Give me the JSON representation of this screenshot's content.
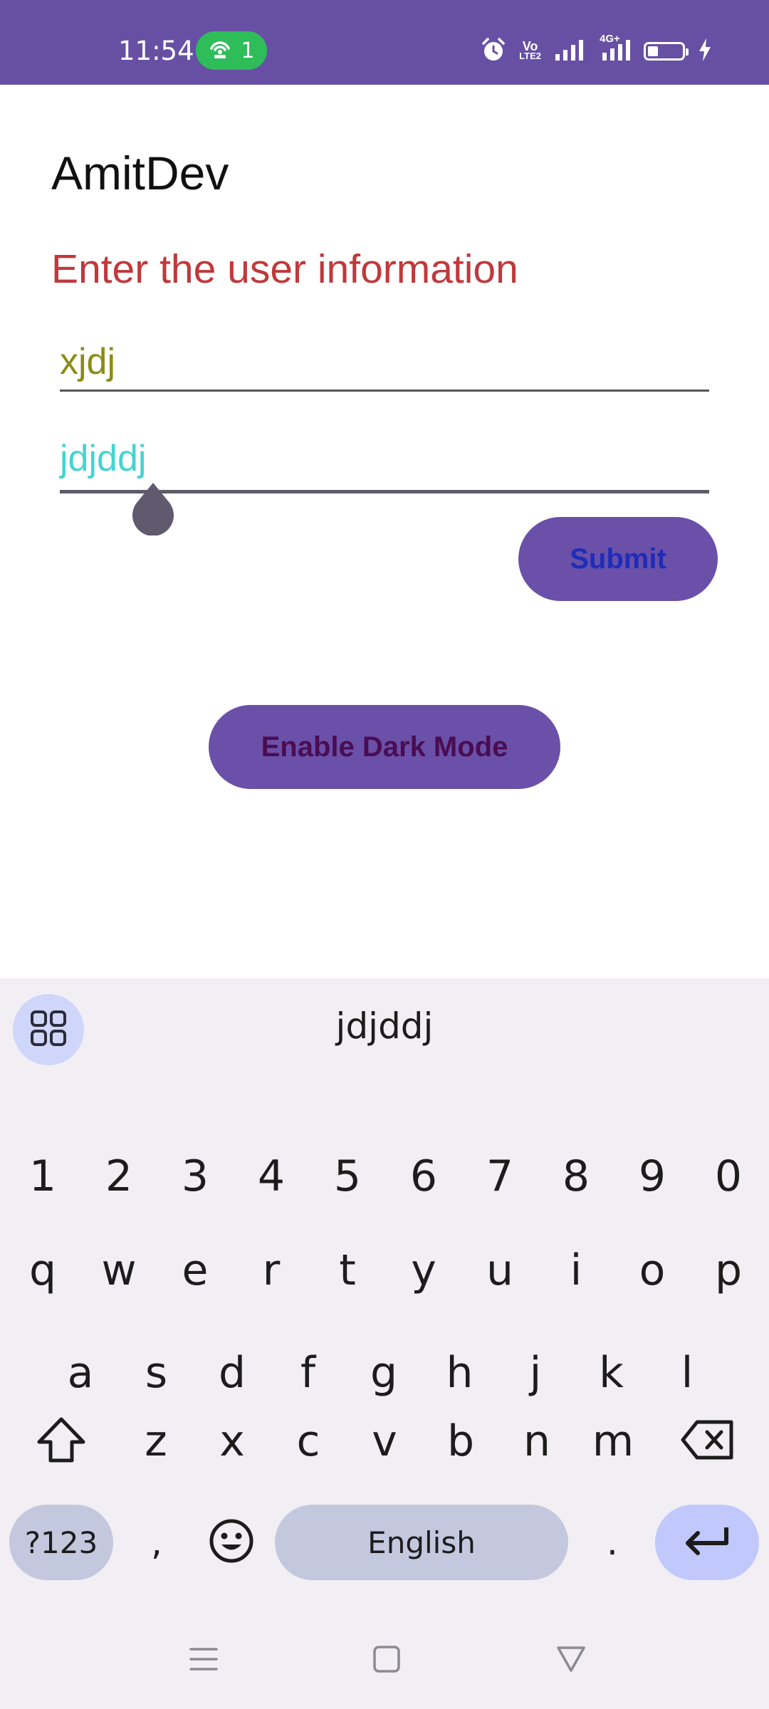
{
  "status_bar": {
    "time": "11:54",
    "hotspot_count": "1",
    "volte_label_top": "Vo",
    "volte_label_bottom": "LTE2",
    "network_label": "4G+",
    "battery_level": 0.3,
    "bar_color": "#6750a4"
  },
  "app": {
    "title": "AmitDev",
    "heading": "Enter the user information",
    "field1_value": "xjdj",
    "field2_value": "jdjddj",
    "submit_label": "Submit",
    "dark_mode_label": "Enable Dark Mode",
    "colors": {
      "heading": "#c0393b",
      "field1_text": "#8b8c17",
      "field2_text": "#43d4d2",
      "button_bg": "#6a50a8",
      "submit_text": "#1d2dba",
      "dark_mode_text": "#4a0d52"
    }
  },
  "keyboard": {
    "suggestion": "jdjddj",
    "row_numbers": [
      "1",
      "2",
      "3",
      "4",
      "5",
      "6",
      "7",
      "8",
      "9",
      "0"
    ],
    "row_top": [
      "q",
      "w",
      "e",
      "r",
      "t",
      "y",
      "u",
      "i",
      "o",
      "p"
    ],
    "row_middle": [
      "a",
      "s",
      "d",
      "f",
      "g",
      "h",
      "j",
      "k",
      "l"
    ],
    "row_bottom": [
      "z",
      "x",
      "c",
      "v",
      "b",
      "n",
      "m"
    ],
    "symbols_label": "?123",
    "comma_label": ",",
    "space_label": "English",
    "period_label": ".",
    "icons": [
      "grid-menu-icon",
      "shift-icon",
      "backspace-icon",
      "emoji-icon",
      "enter-icon"
    ]
  },
  "navigation": {
    "icons": [
      "menu-icon",
      "home-icon",
      "back-icon"
    ]
  }
}
